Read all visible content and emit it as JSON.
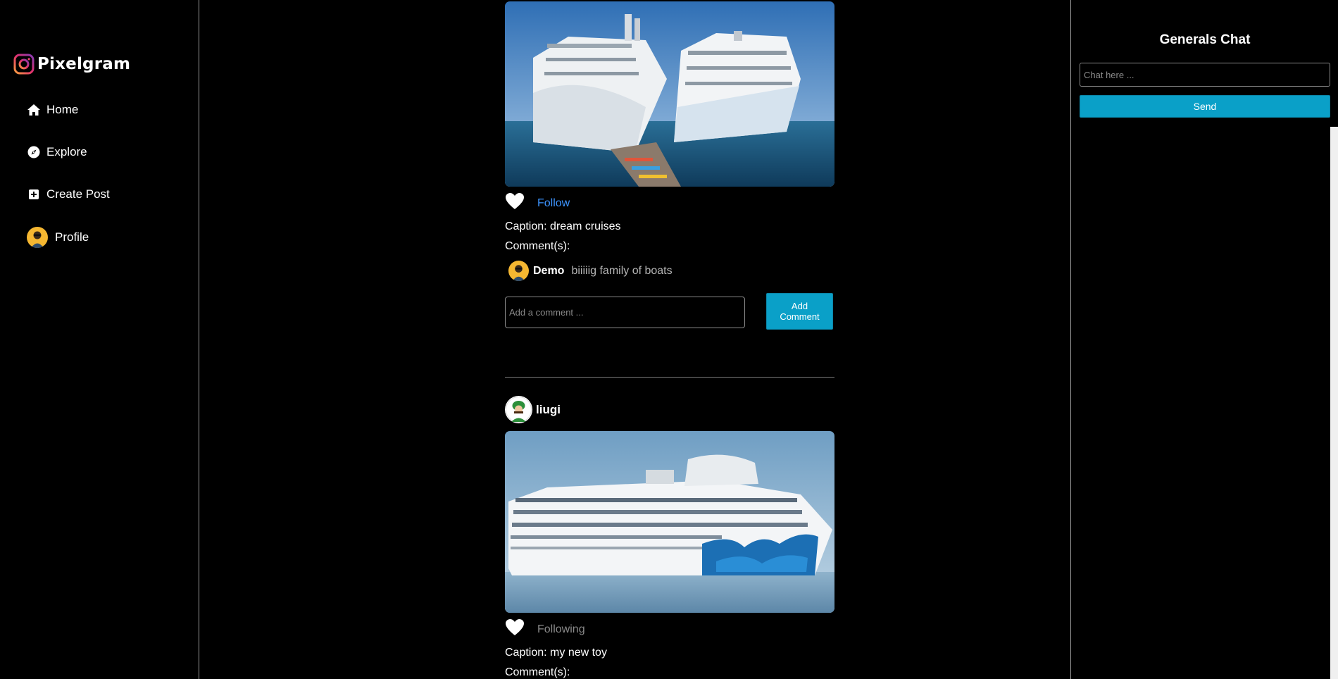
{
  "app": {
    "brand": "Pixelgram"
  },
  "sidebar": {
    "items": [
      {
        "label": "Home",
        "icon": "home-icon"
      },
      {
        "label": "Explore",
        "icon": "compass-icon"
      },
      {
        "label": "Create Post",
        "icon": "plus-square-icon"
      },
      {
        "label": "Profile",
        "icon": "avatar"
      }
    ]
  },
  "chat": {
    "title": "Generals Chat",
    "input_placeholder": "Chat here ...",
    "send_label": "Send"
  },
  "posts": [
    {
      "image": "cruise-ships-docked-side-by-side",
      "follow_label": "Follow",
      "caption": "Caption: dream cruises",
      "comments_label": "Comment(s):",
      "comments": [
        {
          "user": "Demo",
          "text": "biiiiig family of boats"
        }
      ],
      "comment_placeholder": "Add a comment ...",
      "add_comment_label": "Add Comment"
    },
    {
      "author": "liugi",
      "image": "cruise-ship-with-blue-wave-livery",
      "follow_label": "Following",
      "caption": "Caption: my new toy",
      "comments_label": "Comment(s):"
    }
  ],
  "colors": {
    "accent": "#0aa0c8",
    "link": "#3d94ff",
    "muted": "#8a8a8a",
    "background": "#000000"
  }
}
